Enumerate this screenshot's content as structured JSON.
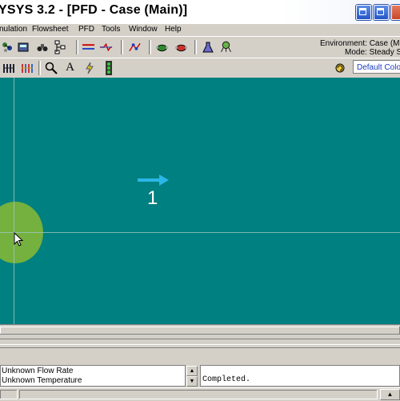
{
  "window": {
    "title": "YSYS 3.2 - [PFD - Case (Main)]"
  },
  "menu": {
    "items": [
      "nulation",
      "Flowsheet",
      "PFD",
      "Tools",
      "Window",
      "Help"
    ]
  },
  "toolbar1": {
    "icons": [
      "molecule-icon",
      "calculator-icon",
      "binoculars-icon",
      "flowchart-icon",
      "stream-lines-icon",
      "stream-cross-icon",
      "diagram-icon",
      "pump-green-icon",
      "pump-red-icon",
      "flask-icon",
      "dashboard-icon"
    ]
  },
  "environment": {
    "env_text": "Environment: Case (Ma",
    "mode_text": "Mode: Steady S"
  },
  "toolbar2": {
    "icons": [
      "bars-icon",
      "bars-colored-icon",
      "zoom-icon",
      "text-icon",
      "lightning-icon",
      "traffic-light-icon",
      "refresh-icon"
    ]
  },
  "color_scheme": {
    "selected": "Default Colo"
  },
  "pfd": {
    "stream_label": "1",
    "colors": {
      "background": "#008080",
      "stream_arrow": "#2ab7e8",
      "highlight": "#7ab33a"
    }
  },
  "status": {
    "messages": [
      "Unknown Flow Rate",
      "Unknown Temperature"
    ],
    "trace": "Completed."
  }
}
